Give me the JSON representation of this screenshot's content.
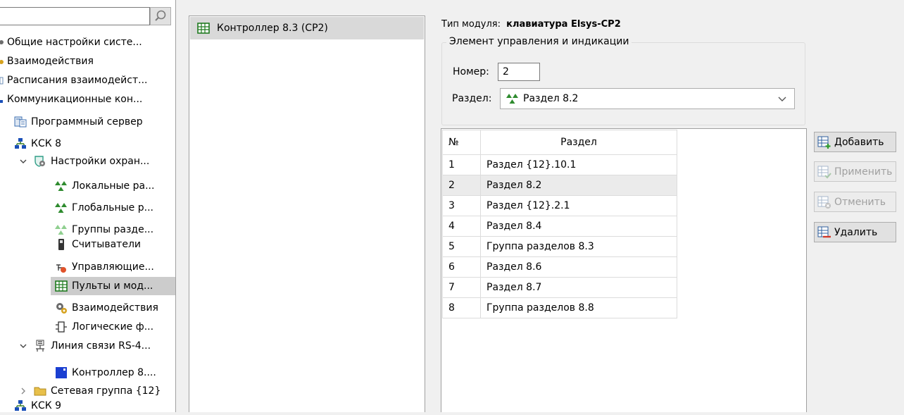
{
  "tree": {
    "search_value": "",
    "items": [
      {
        "label": "Общие настройки систе...",
        "icon": "gear-icon"
      },
      {
        "label": "Взаимодействия",
        "icon": "interaction-icon"
      },
      {
        "label": "Расписания взаимодейст...",
        "icon": "schedule-icon"
      },
      {
        "label": "Коммуникационные кон...",
        "icon": "network-icon"
      },
      {
        "label": "Программный сервер",
        "icon": "server-icon"
      },
      {
        "label": "КСК 8",
        "icon": "network-icon"
      },
      {
        "label": "Настройки охран...",
        "icon": "shield-gear-icon"
      },
      {
        "label": "Локальные ра...",
        "icon": "section-icon"
      },
      {
        "label": "Глобальные р...",
        "icon": "section-icon"
      },
      {
        "label": "Группы разде...",
        "icon": "section-group-icon"
      },
      {
        "label": "Считыватели",
        "icon": "reader-icon"
      },
      {
        "label": "Управляющие...",
        "icon": "control-icon"
      },
      {
        "label": "Пульты и мод...",
        "icon": "keypad-icon"
      },
      {
        "label": "Взаимодействия",
        "icon": "interaction-icon"
      },
      {
        "label": "Логические ф...",
        "icon": "logic-icon"
      },
      {
        "label": "Линия связи RS-4...",
        "icon": "line-icon"
      },
      {
        "label": "Контроллер 8....",
        "icon": "controller-icon"
      },
      {
        "label": "Сетевая группа {12}",
        "icon": "folder-icon"
      },
      {
        "label": "КСК 9",
        "icon": "network-icon"
      }
    ]
  },
  "middle": {
    "item_label": "Контроллер 8.3 (CP2)"
  },
  "module": {
    "type_label": "Тип модуля:",
    "type_value": "клавиатура Elsys-CP2",
    "group_title": "Элемент управления и индикации",
    "number_label": "Номер:",
    "number_value": "2",
    "section_label": "Раздел:",
    "section_value": "Раздел 8.2"
  },
  "table": {
    "col_num": "№",
    "col_name": "Раздел",
    "rows": [
      {
        "num": "1",
        "name": "Раздел {12}.10.1"
      },
      {
        "num": "2",
        "name": "Раздел 8.2"
      },
      {
        "num": "3",
        "name": "Раздел {12}.2.1"
      },
      {
        "num": "4",
        "name": "Раздел 8.4"
      },
      {
        "num": "5",
        "name": "Группа разделов 8.3"
      },
      {
        "num": "6",
        "name": "Раздел 8.6"
      },
      {
        "num": "7",
        "name": "Раздел 8.7"
      },
      {
        "num": "8",
        "name": "Группа разделов 8.8"
      }
    ]
  },
  "buttons": {
    "add": "Добавить",
    "apply": "Применить",
    "cancel": "Отменить",
    "delete": "Удалить"
  },
  "colors": {
    "section_green": "#2e8b2e",
    "keypad_green": "#1f7a1f",
    "controller_blue": "#1a3fd1",
    "folder_yellow": "#e8c04a"
  }
}
